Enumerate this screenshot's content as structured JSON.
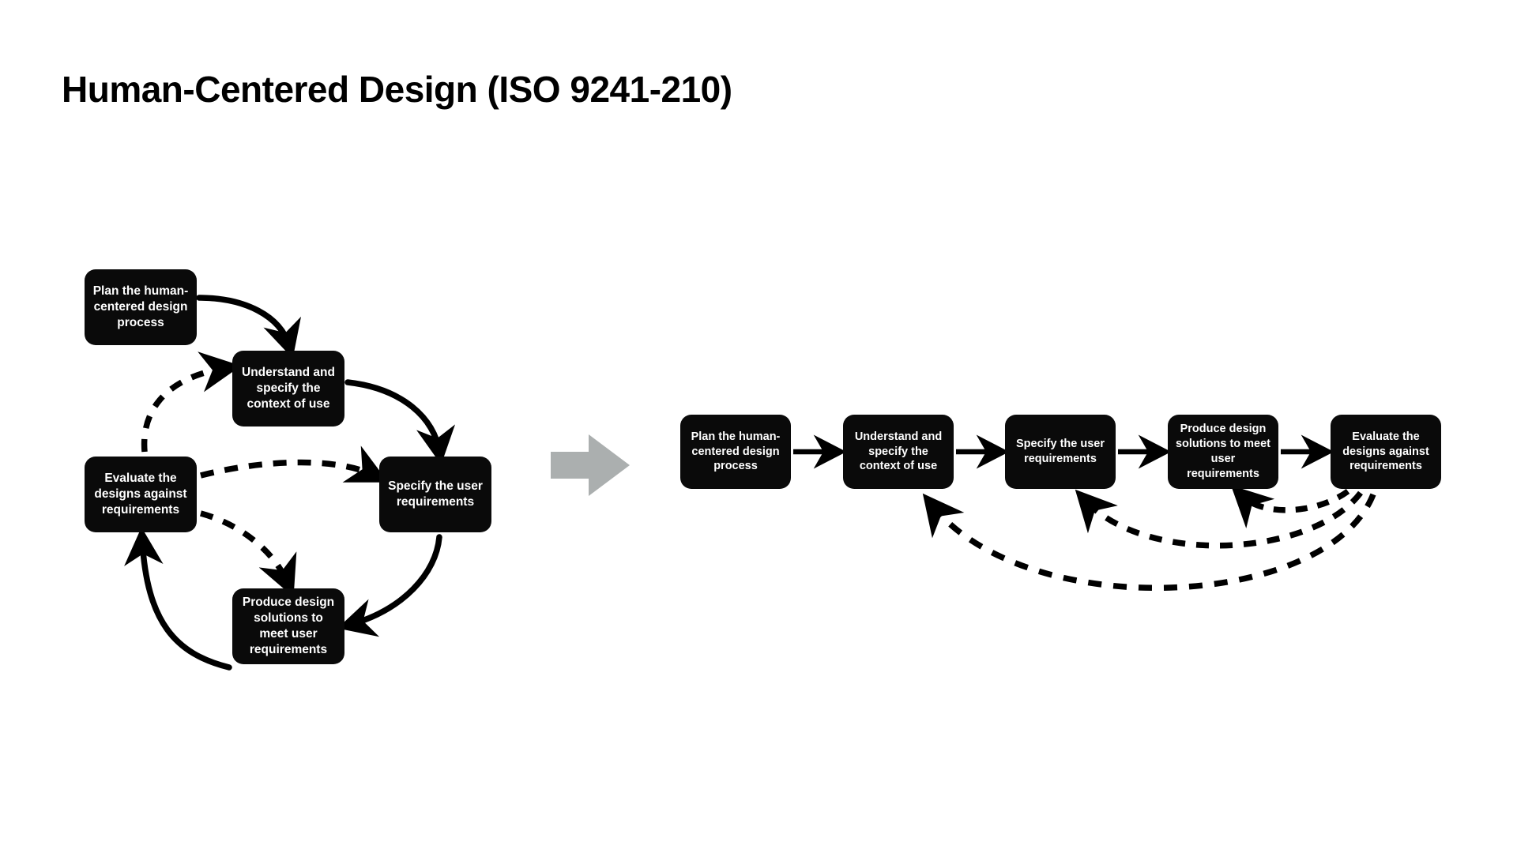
{
  "page": {
    "title": "Human-Centered Design (ISO 9241-210)",
    "background_color": "#ffffff",
    "node_color": "#0a0a0a",
    "node_text_color": "#ffffff",
    "arrow_color": "#000000",
    "transition_arrow_color": "#ABAFAF"
  },
  "steps": {
    "plan": "Plan the human-centered design process",
    "plan_lines": [
      "Plan the human-",
      "centered design",
      "process"
    ],
    "understand": "Understand and specify the context of use",
    "understand_lines": [
      "Understand and",
      "specify the",
      "context of use"
    ],
    "specify": "Specify the user requirements",
    "specify_lines": [
      "Specify the user",
      "requirements"
    ],
    "produce": "Produce design solutions to meet user requirements",
    "produce_lines": [
      "Produce design",
      "solutions to meet",
      "user requirements"
    ],
    "evaluate": "Evaluate the designs against requirements",
    "evaluate_lines": [
      "Evaluate the",
      "designs against",
      "requirements"
    ]
  },
  "left_diagram": {
    "name": "iterative-cycle-diagram",
    "nodes": [
      {
        "id": "plan",
        "label": "Plan the human-centered design process"
      },
      {
        "id": "understand",
        "label": "Understand and specify the context of use"
      },
      {
        "id": "specify",
        "label": "Specify the user requirements"
      },
      {
        "id": "produce",
        "label": "Produce design solutions to meet user requirements"
      },
      {
        "id": "evaluate",
        "label": "Evaluate the designs against requirements"
      }
    ],
    "solid_edges": [
      {
        "from": "plan",
        "to": "understand"
      },
      {
        "from": "understand",
        "to": "specify"
      },
      {
        "from": "specify",
        "to": "produce"
      },
      {
        "from": "produce",
        "to": "evaluate"
      }
    ],
    "dashed_edges": [
      {
        "from": "evaluate",
        "to": "understand"
      },
      {
        "from": "evaluate",
        "to": "specify"
      },
      {
        "from": "evaluate",
        "to": "produce"
      }
    ]
  },
  "transition": {
    "icon": "right-block-arrow-icon",
    "color": "#ABAFAF"
  },
  "right_diagram": {
    "name": "linear-unrolled-diagram",
    "nodes": [
      {
        "id": "plan",
        "label": "Plan the human-centered design process"
      },
      {
        "id": "understand",
        "label": "Understand and specify the context of use"
      },
      {
        "id": "specify",
        "label": "Specify the user requirements"
      },
      {
        "id": "produce",
        "label": "Produce design solutions to meet user requirements"
      },
      {
        "id": "evaluate",
        "label": "Evaluate the designs against requirements"
      }
    ],
    "solid_edges": [
      {
        "from": "plan",
        "to": "understand"
      },
      {
        "from": "understand",
        "to": "specify"
      },
      {
        "from": "specify",
        "to": "produce"
      },
      {
        "from": "produce",
        "to": "evaluate"
      }
    ],
    "dashed_edges": [
      {
        "from": "evaluate",
        "to": "produce"
      },
      {
        "from": "evaluate",
        "to": "specify"
      },
      {
        "from": "evaluate",
        "to": "understand"
      }
    ]
  }
}
